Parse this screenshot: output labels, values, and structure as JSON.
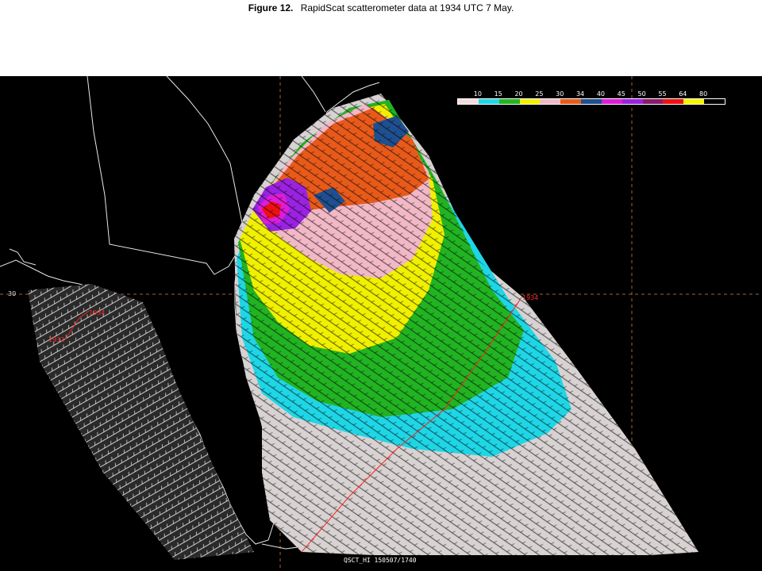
{
  "caption": {
    "figure_label": "Figure 12.",
    "text": "RapidScat  scatterometer data at 1934 UTC 7 May."
  },
  "legend": {
    "values": [
      "10",
      "15",
      "20",
      "25",
      "30",
      "34",
      "40",
      "45",
      "50",
      "55",
      "64",
      "80"
    ],
    "colors": [
      "#f4dcdc",
      "#1fd6e6",
      "#22b322",
      "#f0f000",
      "#f2b8c6",
      "#e85a1a",
      "#1f4f8f",
      "#e01cd6",
      "#9a22e0",
      "#8a1a6a",
      "#ee1111",
      "#f5f500",
      "#000000"
    ]
  },
  "map": {
    "latitude_label": "30",
    "swath_times": {
      "left_top": "1934",
      "left_bottom": "1932",
      "right_top": "1934"
    },
    "product_id": "QSCT_HI  150507/1740"
  }
}
